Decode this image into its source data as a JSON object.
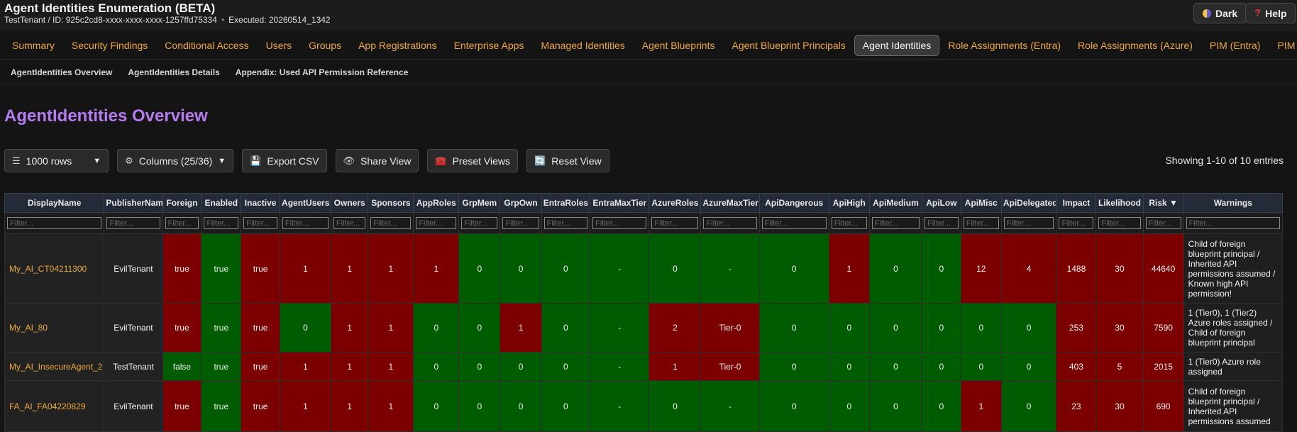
{
  "header": {
    "title": "Agent Identities Enumeration (BETA)",
    "tenant": "TestTenant / ID: 925c2cd8-xxxx-xxxx-xxxx-1257ffd75334",
    "executed": "Executed: 20260514_1342",
    "theme_label": "Dark",
    "help_label": "Help"
  },
  "tabs": [
    "Summary",
    "Security Findings",
    "Conditional Access",
    "Users",
    "Groups",
    "App Registrations",
    "Enterprise Apps",
    "Managed Identities",
    "Agent Blueprints",
    "Agent Blueprint Principals",
    "Agent Identities",
    "Role Assignments (Entra)",
    "Role Assignments (Azure)",
    "PIM (Entra)",
    "PIM (Groups)"
  ],
  "active_tab": "Agent Identities",
  "subnav": [
    "AgentIdentities Overview",
    "AgentIdentities Details",
    "Appendix: Used API Permission Reference"
  ],
  "section_title": "AgentIdentities Overview",
  "toolbar": {
    "rows_label": "1000 rows",
    "columns_label": "Columns (25/36)",
    "export_label": "Export CSV",
    "share_label": "Share View",
    "preset_label": "Preset Views",
    "reset_label": "Reset View"
  },
  "showing": "Showing 1-10 of 10 entries",
  "filter_placeholder": "Filter...",
  "columns": [
    "DisplayName",
    "PublisherName",
    "Foreign",
    "Enabled",
    "Inactive",
    "AgentUsers",
    "Owners",
    "Sponsors",
    "AppRoles",
    "GrpMem",
    "GrpOwn",
    "EntraRoles",
    "EntraMaxTier",
    "AzureRoles",
    "AzureMaxTier",
    "ApiDangerous",
    "ApiHigh",
    "ApiMedium",
    "ApiLow",
    "ApiMisc",
    "ApiDelegated",
    "Impact",
    "Likelihood",
    "Risk ▼",
    "Warnings"
  ],
  "rows": [
    {
      "cells": [
        "My_AI_CT04211300",
        "EvilTenant",
        "true",
        "true",
        "true",
        "1",
        "1",
        "1",
        "1",
        "0",
        "0",
        "0",
        "-",
        "0",
        "-",
        "0",
        "1",
        "0",
        "0",
        "12",
        "4",
        "1488",
        "30",
        "44640",
        "Child of foreign blueprint principal / Inherited API permissions assumed / Known high API permission!"
      ],
      "colors": [
        "plain",
        "plain",
        "red",
        "green",
        "red",
        "red",
        "red",
        "red",
        "red",
        "green",
        "green",
        "green",
        "green",
        "green",
        "green",
        "green",
        "red",
        "green",
        "green",
        "red",
        "red",
        "red",
        "red",
        "red",
        "plain"
      ]
    },
    {
      "cells": [
        "My_AI_80",
        "EvilTenant",
        "true",
        "true",
        "true",
        "0",
        "1",
        "1",
        "0",
        "0",
        "1",
        "0",
        "-",
        "2",
        "Tier-0",
        "0",
        "0",
        "0",
        "0",
        "0",
        "0",
        "253",
        "30",
        "7590",
        "1 (Tier0), 1 (Tier2) Azure roles assigned / Child of foreign blueprint principal"
      ],
      "colors": [
        "plain",
        "plain",
        "red",
        "green",
        "red",
        "green",
        "red",
        "red",
        "green",
        "green",
        "red",
        "green",
        "green",
        "red",
        "red",
        "green",
        "green",
        "green",
        "green",
        "green",
        "green",
        "red",
        "red",
        "red",
        "plain"
      ]
    },
    {
      "cells": [
        "My_AI_InsecureAgent_2",
        "TestTenant",
        "false",
        "true",
        "true",
        "1",
        "1",
        "1",
        "0",
        "0",
        "0",
        "0",
        "-",
        "1",
        "Tier-0",
        "0",
        "0",
        "0",
        "0",
        "0",
        "0",
        "403",
        "5",
        "2015",
        "1 (Tier0) Azure role assigned"
      ],
      "colors": [
        "plain",
        "plain",
        "green",
        "green",
        "red",
        "red",
        "red",
        "red",
        "green",
        "green",
        "green",
        "green",
        "green",
        "red",
        "red",
        "green",
        "green",
        "green",
        "green",
        "green",
        "green",
        "red",
        "red",
        "red",
        "plain"
      ]
    },
    {
      "cells": [
        "FA_AI_FA04220829",
        "EvilTenant",
        "true",
        "true",
        "true",
        "1",
        "1",
        "1",
        "0",
        "0",
        "0",
        "0",
        "-",
        "0",
        "-",
        "0",
        "0",
        "0",
        "0",
        "1",
        "0",
        "23",
        "30",
        "690",
        "Child of foreign blueprint principal / Inherited API permissions assumed"
      ],
      "colors": [
        "plain",
        "plain",
        "red",
        "green",
        "red",
        "red",
        "red",
        "red",
        "green",
        "green",
        "green",
        "green",
        "green",
        "green",
        "green",
        "green",
        "green",
        "green",
        "green",
        "red",
        "green",
        "red",
        "red",
        "red",
        "plain"
      ]
    }
  ]
}
